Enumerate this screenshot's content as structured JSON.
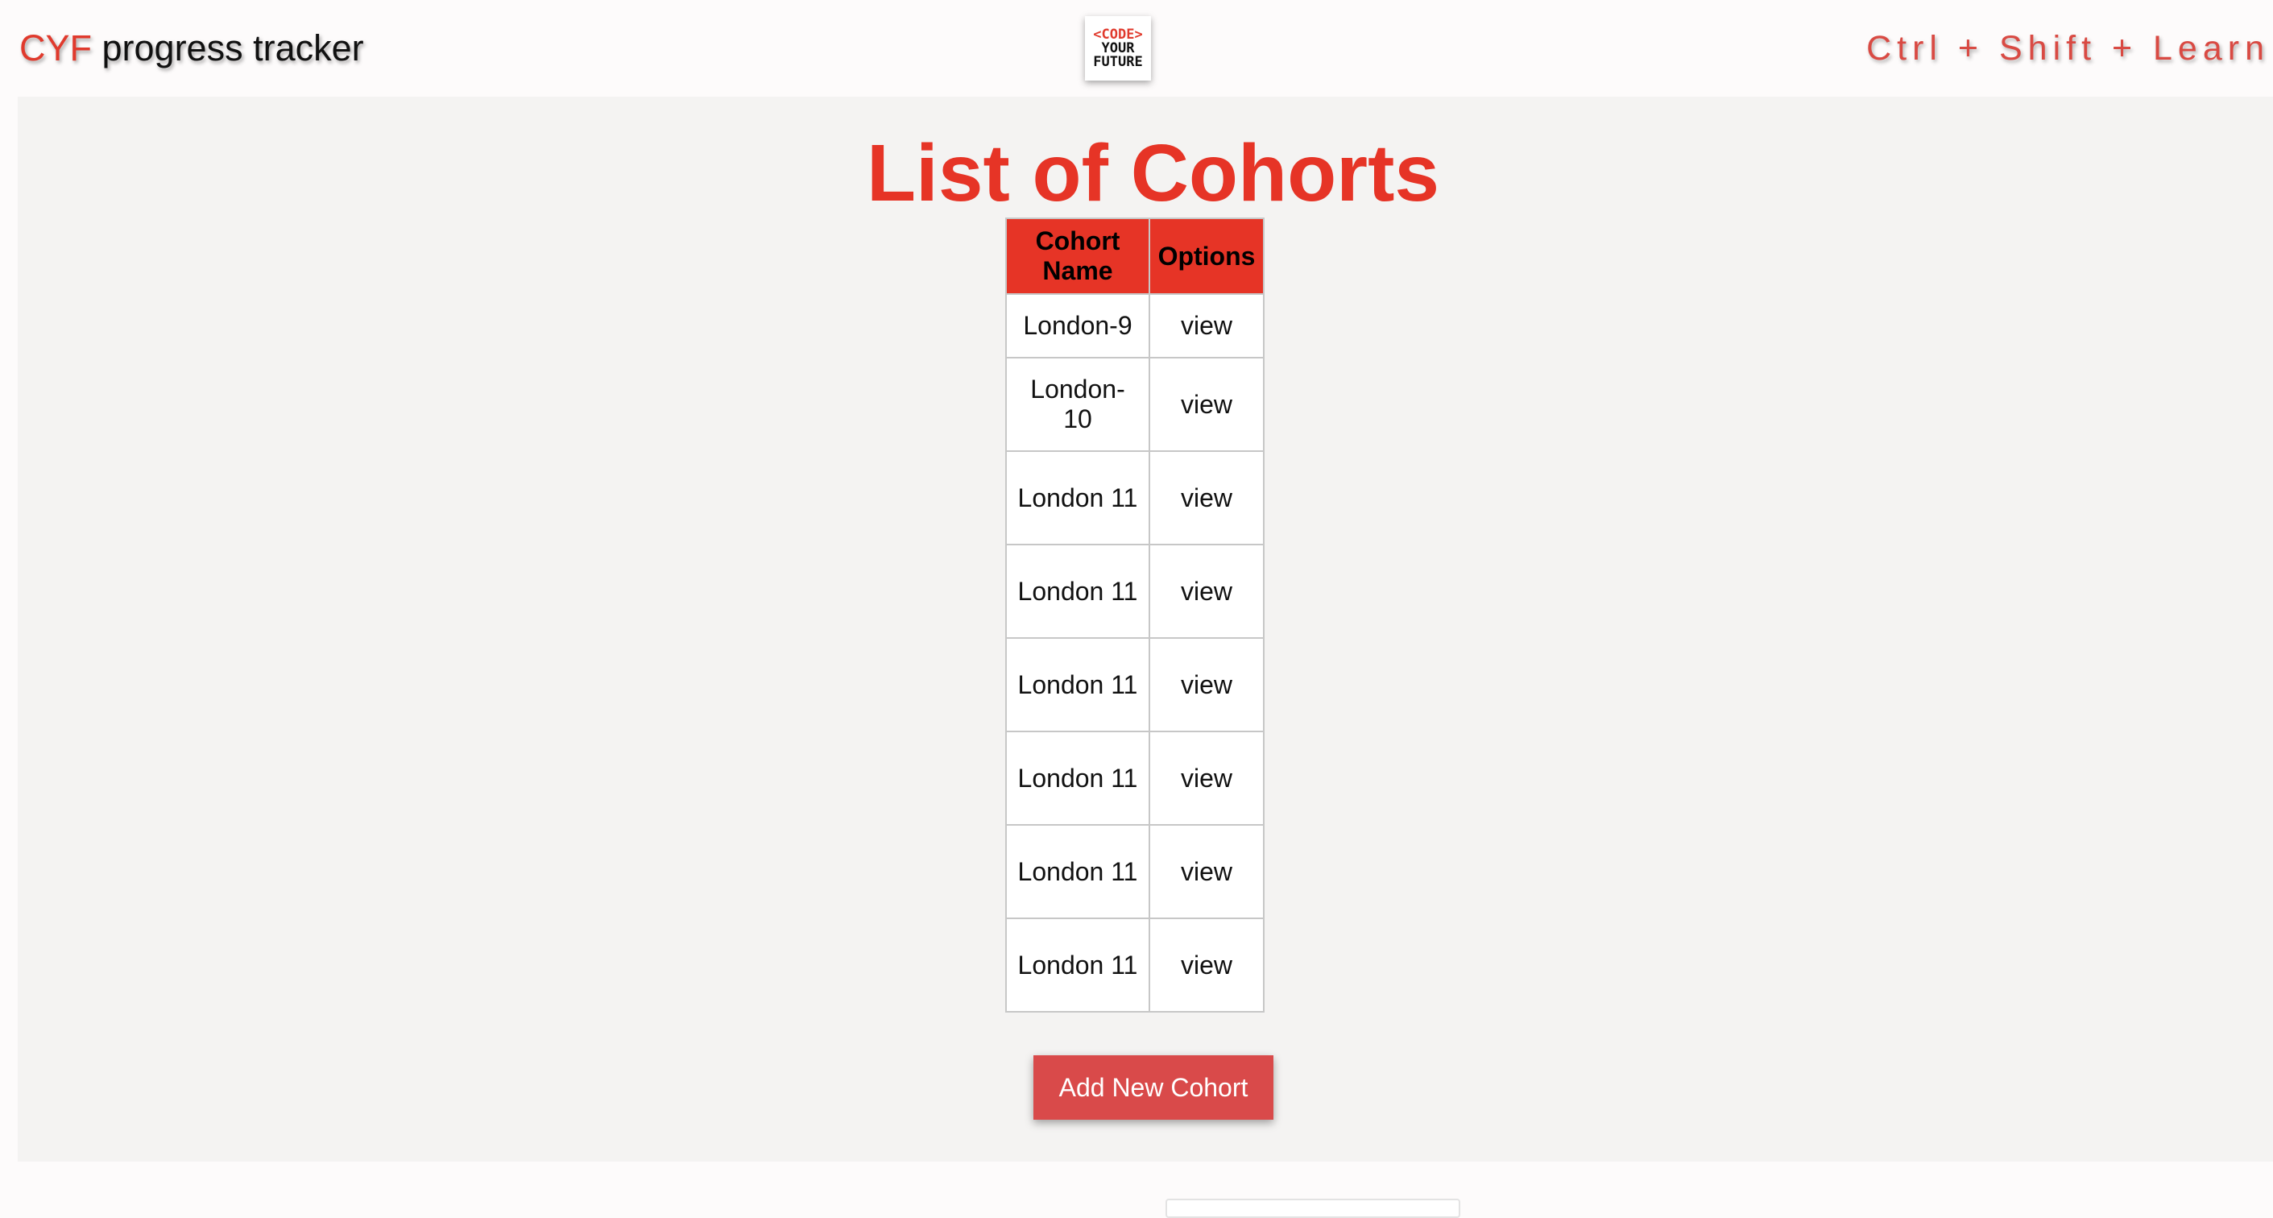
{
  "header": {
    "brand_short": "CYF",
    "brand_rest": " progress tracker",
    "logo_lines": [
      "<CODE>",
      "YOUR",
      "FUTURE"
    ],
    "slogan": "Ctrl + Shift + Learn"
  },
  "main": {
    "title": "List of Cohorts",
    "table": {
      "headers": [
        "Cohort Name",
        "Options"
      ],
      "rows": [
        {
          "name": "London-9",
          "option": "view"
        },
        {
          "name": "London-10",
          "option": "view"
        },
        {
          "name": "London 11",
          "option": "view"
        },
        {
          "name": "London 11",
          "option": "view"
        },
        {
          "name": "London 11",
          "option": "view"
        },
        {
          "name": "London 11",
          "option": "view"
        },
        {
          "name": "London 11",
          "option": "view"
        },
        {
          "name": "London 11",
          "option": "view"
        }
      ]
    },
    "add_button_label": "Add New Cohort"
  },
  "colors": {
    "accent": "#e63426",
    "button": "#d94a4a",
    "page_bg": "#f4f3f2"
  }
}
